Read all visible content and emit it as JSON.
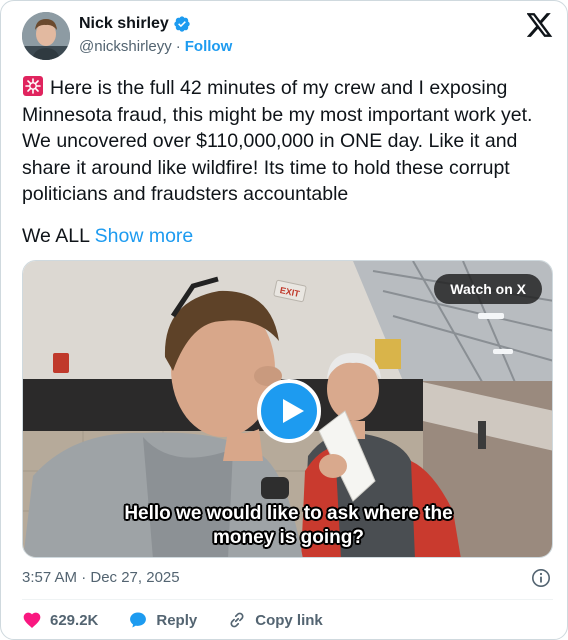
{
  "author": {
    "name": "Nick shirley",
    "handle": "@nickshirleyy",
    "separator": "·",
    "follow_label": "Follow",
    "verified": true
  },
  "header": {
    "logo_icon": "x-logo-icon"
  },
  "tweet": {
    "text": "Here is the full 42 minutes of my crew and I exposing Minnesota fraud, this might be my most important work yet. We uncovered over $110,000,000 in ONE day. Like it and share it around like wildfire! Its time to hold these corrupt politicians and fraudsters accountable",
    "leading_emoji": "siren-icon",
    "truncated_text": "We ALL",
    "show_more_label": "Show more"
  },
  "media": {
    "watch_label": "Watch on X",
    "caption_line1": "Hello we would like to ask where the",
    "caption_line2": "money is going?",
    "sign_text": "EXIT"
  },
  "meta": {
    "timestamp": "3:57 AM · Dec 27, 2025"
  },
  "actions": {
    "likes_count": "629.2K",
    "reply_label": "Reply",
    "copy_link_label": "Copy link"
  },
  "colors": {
    "accent": "#1d9bf0",
    "like": "#f91880",
    "text_primary": "#0f1419",
    "text_secondary": "#536471"
  }
}
